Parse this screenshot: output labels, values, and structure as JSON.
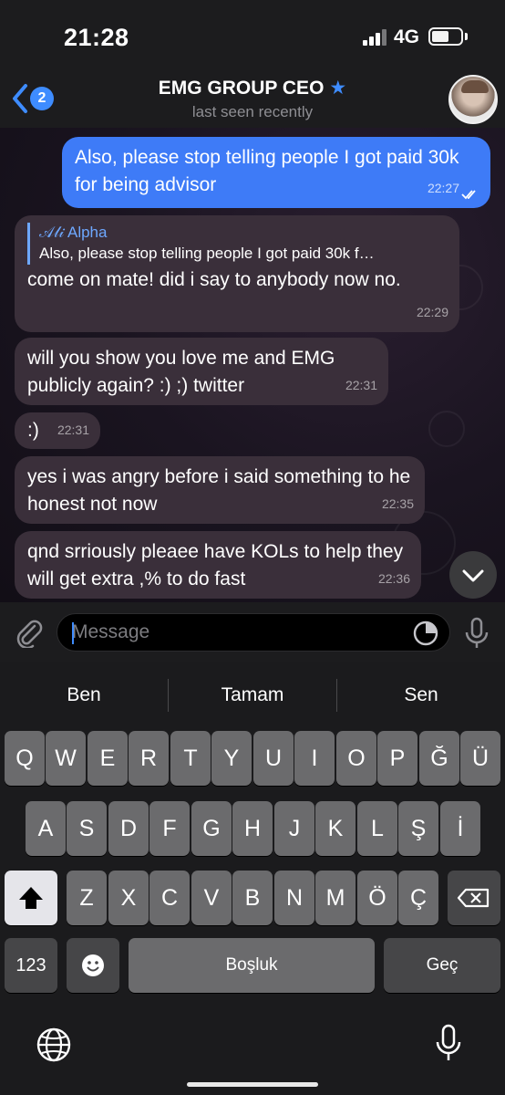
{
  "status_bar": {
    "time": "21:28",
    "network": "4G"
  },
  "header": {
    "back_badge": "2",
    "title": "EMG GROUP CEO",
    "subtitle": "last seen recently"
  },
  "messages": [
    {
      "direction": "out",
      "text": "Also, please stop telling people I got paid 30k for being advisor",
      "time": "22:27"
    },
    {
      "direction": "in",
      "reply_name": "𝒜𝓁𝒾 Alpha",
      "reply_text": "Also, please stop telling people I got paid 30k f…",
      "text": "come on mate! did i say to anybody now no.",
      "time": "22:29"
    },
    {
      "direction": "in",
      "text": "will you show you love me and EMG publicly again? :) ;) twitter",
      "time": "22:31"
    },
    {
      "direction": "in",
      "text": ":)",
      "time": "22:31"
    },
    {
      "direction": "in",
      "text": "yes i was angry before i said something to he honest not now",
      "time": "22:35"
    },
    {
      "direction": "in",
      "text": "qnd srriously pleaee have KOLs to help they will get extra ,% to do fast",
      "time": "22:36"
    }
  ],
  "composer": {
    "placeholder": "Message"
  },
  "keyboard": {
    "suggestions": [
      "Ben",
      "Tamam",
      "Sen"
    ],
    "row1": [
      "Q",
      "W",
      "E",
      "R",
      "T",
      "Y",
      "U",
      "I",
      "O",
      "P",
      "Ğ",
      "Ü"
    ],
    "row2": [
      "A",
      "S",
      "D",
      "F",
      "G",
      "H",
      "J",
      "K",
      "L",
      "Ş",
      "İ"
    ],
    "row3": [
      "Z",
      "X",
      "C",
      "V",
      "B",
      "N",
      "M",
      "Ö",
      "Ç"
    ],
    "numbers_key": "123",
    "space_key": "Boşluk",
    "return_key": "Geç"
  },
  "colors": {
    "accent": "#3e8cff",
    "outgoing_bubble": "#3e7bf7",
    "incoming_bubble": "#3a2f3a"
  }
}
